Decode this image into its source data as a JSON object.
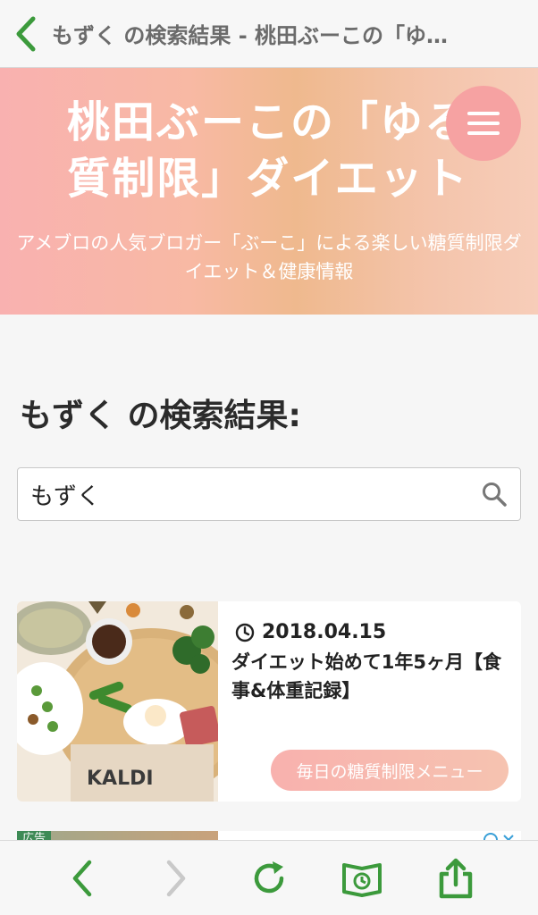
{
  "topbar": {
    "title": "もずく の検索結果 - 桃田ぶーこの「ゆ…"
  },
  "hero": {
    "title_line1": "桃田ぶーこの「ゆる",
    "title_line2": "質制限」ダイエット",
    "subtitle": "アメブロの人気ブロガー「ぶーこ」による楽しい糖質制限ダイエット＆健康情報"
  },
  "page": {
    "heading": "もずく の検索結果:"
  },
  "search": {
    "value": "もずく"
  },
  "results": [
    {
      "date": "2018.04.15",
      "title": "ダイエット始めて1年5ヶ月【食事&体重記録】",
      "tag": "毎日の糖質制限メニュー",
      "thumb_text": "KALDI"
    }
  ],
  "ad": {
    "label": "広告"
  },
  "colors": {
    "accent": "#3c9a3c",
    "tag": "#f8b1ae",
    "hero_start": "#f9b1b0",
    "hero_end": "#f7cdb9"
  },
  "icons": [
    "back-chevron-icon",
    "menu-icon",
    "search-icon",
    "clock-icon",
    "nav-back-icon",
    "nav-forward-icon",
    "reload-icon",
    "bookmarks-icon",
    "share-icon"
  ]
}
